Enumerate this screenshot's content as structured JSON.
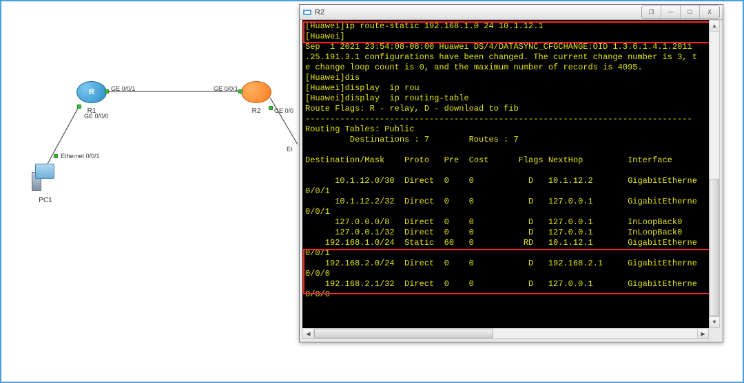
{
  "topology": {
    "r1": {
      "label": "R1",
      "letter": "R"
    },
    "r2": {
      "label": "R2"
    },
    "pc1": {
      "label": "PC1"
    },
    "links": {
      "r1_ge001": "GE 0/0/1",
      "r1_ge000": "GE 0/0/0",
      "r2_ge001": "GE 0/0/1",
      "r2_ge000": "GE 0/0",
      "pc_eth": "Ethernet 0/0/1",
      "eth_cut": "Et"
    }
  },
  "terminal": {
    "title": "R2",
    "lines": [
      "[Huawei]ip route-static 192.168.1.0 24 10.1.12.1",
      "[Huawei]",
      "Sep  1 2021 23:54:08-08:00 Huawei DS/4/DATASYNC_CFGCHANGE:OID 1.3.6.1.4.1.2011",
      ".25.191.3.1 configurations have been changed. The current change number is 3, t",
      "e change loop count is 0, and the maximum number of records is 4095.",
      "[Huawei]dis",
      "[Huawei]display  ip rou",
      "[Huawei]display  ip routing-table",
      "Route Flags: R - relay, D - download to fib",
      "------------------------------------------------------------------------------",
      "Routing Tables: Public",
      "         Destinations : 7        Routes : 7",
      "",
      "Destination/Mask    Proto   Pre  Cost      Flags NextHop         Interface",
      "",
      "      10.1.12.0/30  Direct  0    0           D   10.1.12.2       GigabitEtherne",
      "0/0/1",
      "      10.1.12.2/32  Direct  0    0           D   127.0.0.1       GigabitEtherne",
      "0/0/1",
      "      127.0.0.0/8   Direct  0    0           D   127.0.0.1       InLoopBack0",
      "      127.0.0.1/32  Direct  0    0           D   127.0.0.1       InLoopBack0",
      "    192.168.1.0/24  Static  60   0          RD   10.1.12.1       GigabitEtherne",
      "0/0/1",
      "    192.168.2.0/24  Direct  0    0           D   192.168.2.1     GigabitEtherne",
      "0/0/0",
      "    192.168.2.1/32  Direct  0    0           D   127.0.0.1       GigabitEtherne",
      "0/0/0"
    ]
  },
  "routing_table": {
    "destinations": 7,
    "routes": 7,
    "flags_legend": "R - relay, D - download to fib",
    "columns": [
      "Destination/Mask",
      "Proto",
      "Pre",
      "Cost",
      "Flags",
      "NextHop",
      "Interface"
    ],
    "rows": [
      {
        "dest": "10.1.12.0/30",
        "proto": "Direct",
        "pre": 0,
        "cost": 0,
        "flags": "D",
        "nexthop": "10.1.12.2",
        "iface": "GigabitEthernet0/0/1"
      },
      {
        "dest": "10.1.12.2/32",
        "proto": "Direct",
        "pre": 0,
        "cost": 0,
        "flags": "D",
        "nexthop": "127.0.0.1",
        "iface": "GigabitEthernet0/0/1"
      },
      {
        "dest": "127.0.0.0/8",
        "proto": "Direct",
        "pre": 0,
        "cost": 0,
        "flags": "D",
        "nexthop": "127.0.0.1",
        "iface": "InLoopBack0"
      },
      {
        "dest": "127.0.0.1/32",
        "proto": "Direct",
        "pre": 0,
        "cost": 0,
        "flags": "D",
        "nexthop": "127.0.0.1",
        "iface": "InLoopBack0"
      },
      {
        "dest": "192.168.1.0/24",
        "proto": "Static",
        "pre": 60,
        "cost": 0,
        "flags": "RD",
        "nexthop": "10.1.12.1",
        "iface": "GigabitEthernet0/0/1"
      },
      {
        "dest": "192.168.2.0/24",
        "proto": "Direct",
        "pre": 0,
        "cost": 0,
        "flags": "D",
        "nexthop": "192.168.2.1",
        "iface": "GigabitEthernet0/0/0"
      },
      {
        "dest": "192.168.2.1/32",
        "proto": "Direct",
        "pre": 0,
        "cost": 0,
        "flags": "D",
        "nexthop": "127.0.0.1",
        "iface": "GigabitEthernet0/0/0"
      }
    ]
  },
  "window_controls": {
    "restore": "❐",
    "min": "—",
    "max": "☐",
    "close": "X"
  }
}
